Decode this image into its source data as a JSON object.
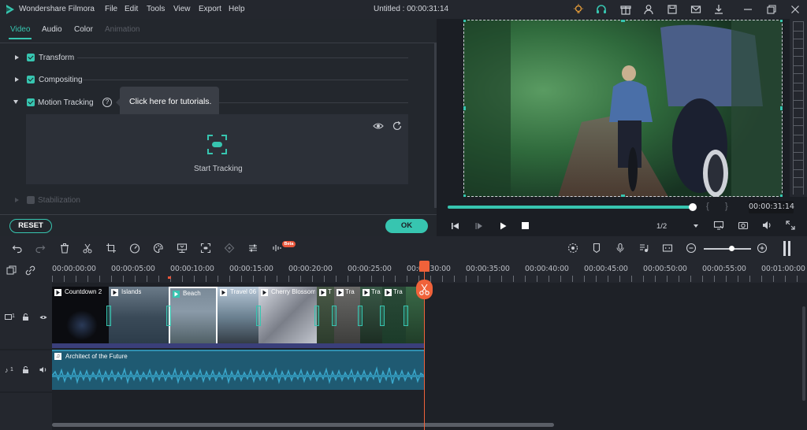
{
  "app": {
    "name": "Wondershare Filmora",
    "project_title": "Untitled : 00:00:31:14",
    "menu": [
      "File",
      "Edit",
      "Tools",
      "View",
      "Export",
      "Help"
    ]
  },
  "panel": {
    "tabs": [
      "Video",
      "Audio",
      "Color",
      "Animation"
    ],
    "sections": {
      "transform": "Transform",
      "compositing": "Compositing",
      "motion_tracking": "Motion Tracking",
      "stabilization": "Stabilization"
    },
    "tooltip": "Click here for tutorials.",
    "start_tracking": "Start Tracking",
    "reset_label": "RESET",
    "ok_label": "OK"
  },
  "preview": {
    "timecode": "00:00:31:14",
    "quality": "1/2",
    "progress": 0.995
  },
  "toolbar": {
    "beta_badge": "Beta"
  },
  "ruler": {
    "ticks": [
      "00:00:00:00",
      "00:00:05:00",
      "00:00:10:00",
      "00:00:15:00",
      "00:00:20:00",
      "00:00:25:00",
      "00:00:30:00",
      "00:00:35:00",
      "00:00:40:00",
      "00:00:45:00",
      "00:00:50:00",
      "00:00:55:00",
      "00:01:00:00"
    ]
  },
  "tracks": {
    "video_clips": [
      "Countdown 2",
      "Islands",
      "Beach",
      "Travel 06",
      "Cherry Blossom",
      "T",
      "Tra",
      "Tra",
      "Tra"
    ],
    "audio_clip": "Architect of the Future",
    "video_track_label": "1",
    "audio_track_label": "1"
  },
  "colors": {
    "accent": "#37c5b0",
    "playhead": "#f0623a",
    "audio": "#2f8fb0",
    "video_bar": "#3a3f7a"
  }
}
